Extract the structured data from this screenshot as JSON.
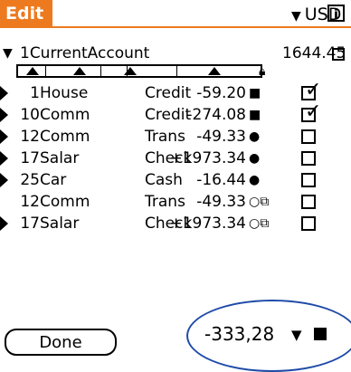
{
  "app": {
    "title": "Edit",
    "currency": "USD",
    "info_glyph": "i"
  },
  "account": {
    "name": "1CurrentAccount",
    "total": "1644.45"
  },
  "transactions": [
    {
      "date": "1",
      "desc": "House",
      "category": "Credit",
      "amount": "-59.20",
      "status": "■",
      "checked": true
    },
    {
      "date": "10",
      "desc": "Comm",
      "category": "Credit",
      "amount": "-274.08",
      "status": "■",
      "checked": true
    },
    {
      "date": "12",
      "desc": "Comm",
      "category": "Trans",
      "amount": "-49.33",
      "status": "●",
      "checked": false
    },
    {
      "date": "17",
      "desc": "Salar",
      "category": "Check",
      "amount": "+1973.34",
      "status": "●",
      "checked": false
    },
    {
      "date": "25",
      "desc": "Car",
      "category": "Cash",
      "amount": "-16.44",
      "status": "●",
      "checked": false
    },
    {
      "date": "12",
      "desc": "Comm",
      "category": "Trans",
      "amount": "-49.33",
      "status": "○⧉",
      "checked": false
    },
    {
      "date": "17",
      "desc": "Salar",
      "category": "Check",
      "amount": "+1973.34",
      "status": "○⧉",
      "checked": false
    }
  ],
  "footer": {
    "done_label": "Done",
    "balance": "-333,28"
  },
  "colors": {
    "accent": "#ed7a1f",
    "highlight_ring": "#1f4aa8"
  }
}
